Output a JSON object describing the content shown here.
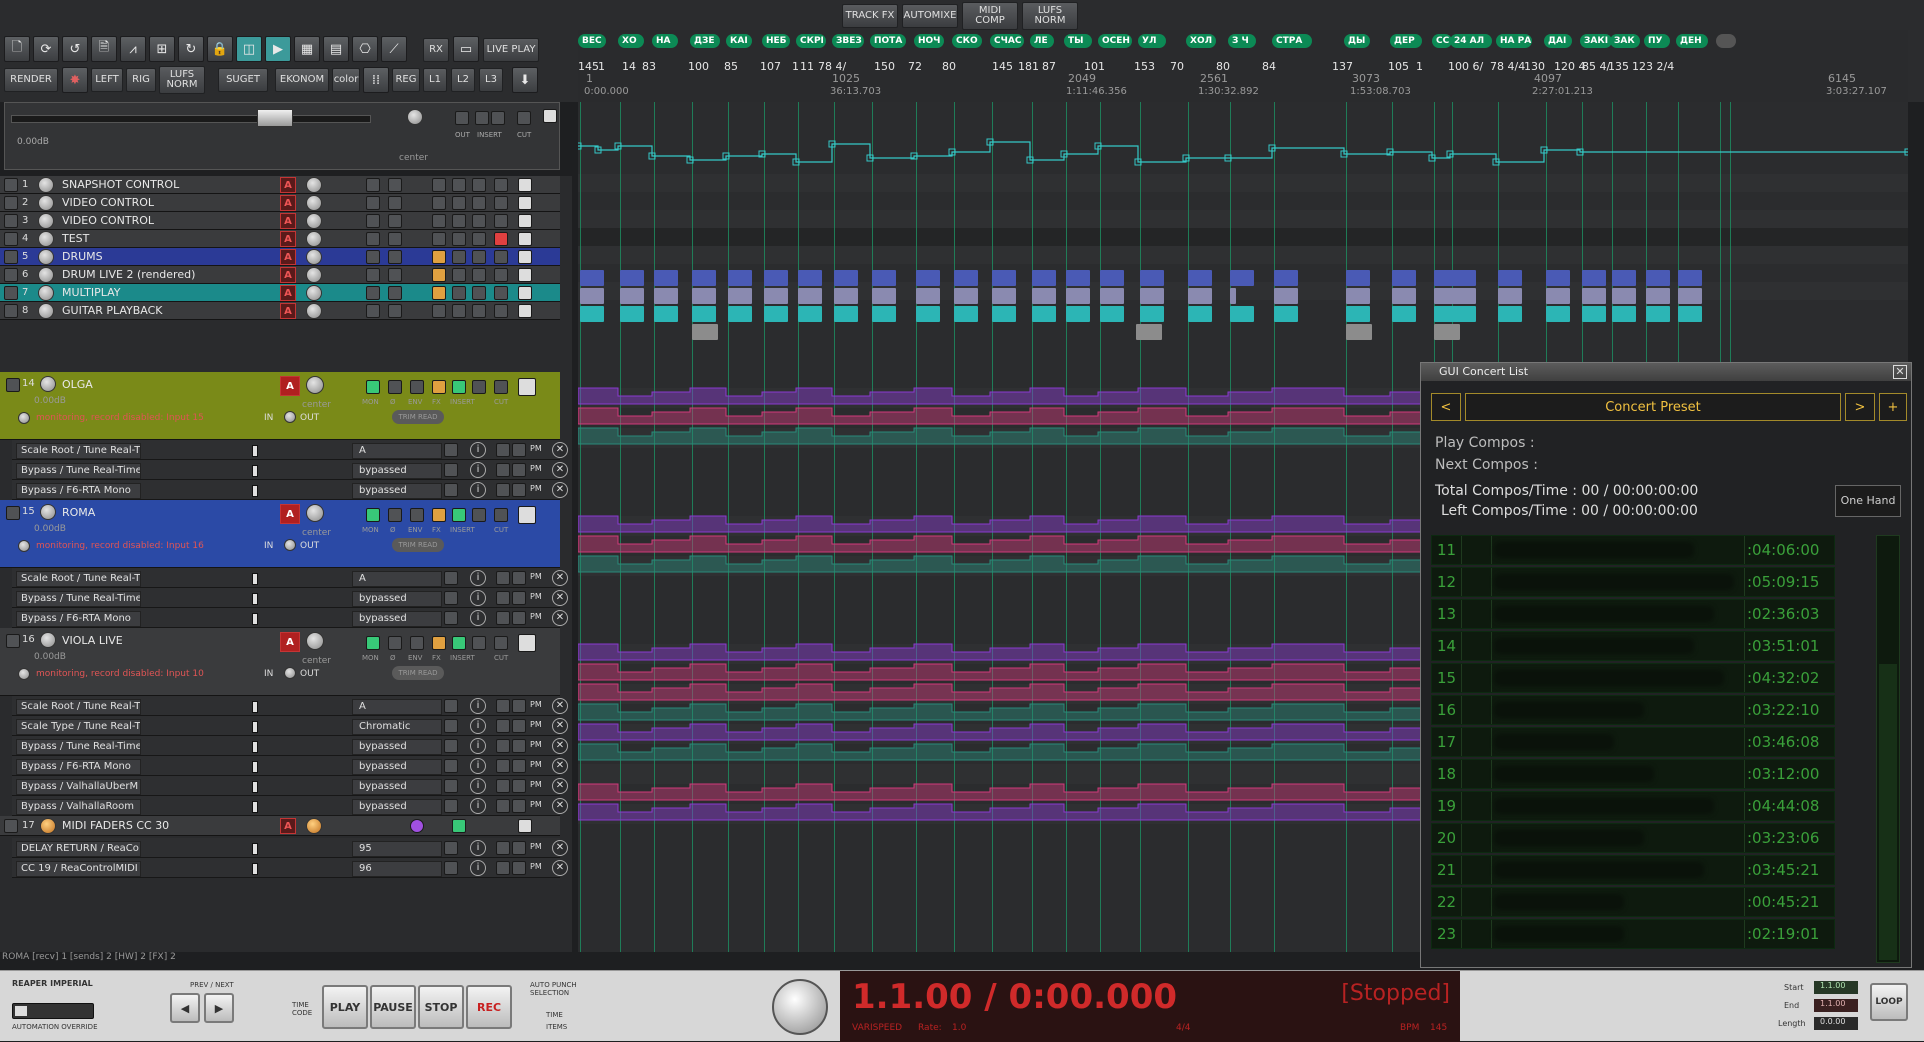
{
  "toolbar": {
    "row1_icons": [
      "new-project-icon",
      "open-project-icon",
      "save-icon",
      "save-as-icon",
      "metronome-icon",
      "grid-icon",
      "loop-icon",
      "lock-icon",
      "snap-icon",
      "ripple-icon",
      "mixer-icon",
      "piano-roll-icon",
      "routing-icon",
      "waveform-icon"
    ],
    "rx": "RX",
    "live_play": "LIVE PLAY",
    "render": "RENDER",
    "left": "LEFT",
    "rig": "RIG",
    "lufs_norm": "LUFS NORM",
    "suget": "SUGET",
    "ekonom": "EKONOM",
    "color": "color",
    "reg": "REG",
    "l1": "L1",
    "l2": "L2",
    "l3": "L3",
    "track_fx": "TRACK FX",
    "automixe": "AUTOMIXE",
    "midi_comp": "MIDI COMP",
    "lufs_norm2": "LUFS NORM"
  },
  "master": {
    "volume": "0.00dB",
    "pan": "center",
    "labels": [
      "OUT",
      "INSERT",
      "CUT"
    ]
  },
  "regions": [
    "ВЕС",
    "ХО",
    "НА",
    "ДЗЕ",
    "КАІ",
    "НЕБ",
    "СКРІ",
    "ЗВЕЗ",
    "ПОТА",
    "НОЧ",
    "СКО",
    "СЧАС",
    "ЛЕ",
    "ТЫ",
    "ОСЕН",
    "УЛ",
    "ХОЛ",
    "З Ч",
    "СТРА",
    "ДЫ",
    "ДЕР",
    "СС",
    "24 АЛ",
    "НА РА",
    "ДАІ",
    "ЗАКІ",
    "ЗАК",
    "ПУ",
    "ДЕН"
  ],
  "marker_numbers": [
    "145",
    "1",
    "14",
    "83",
    "100",
    "85",
    "107",
    "1",
    "11",
    "78 4/",
    "150",
    "72",
    "80",
    "145",
    "181",
    "87",
    "101",
    "153",
    "70",
    "80",
    "84",
    "137",
    "105",
    "1",
    "100 6/",
    "78 4/4",
    "130",
    "120 4",
    "85 4/",
    "135",
    "123 2/4"
  ],
  "bar_numbers": [
    "1",
    "0:00.000",
    "1025",
    "36:13.703",
    "2049",
    "1:11:46.356",
    "2561",
    "1:30:32.892",
    "3073",
    "1:53:08.703",
    "4097",
    "2:27:01.213",
    "6145",
    "3:03:27.107"
  ],
  "tracks": [
    {
      "num": "1",
      "name": "SNAPSHOT CONTROL"
    },
    {
      "num": "2",
      "name": "VIDEO CONTROL"
    },
    {
      "num": "3",
      "name": "VIDEO CONTROL"
    },
    {
      "num": "4",
      "name": "TEST"
    },
    {
      "num": "5",
      "name": "DRUMS"
    },
    {
      "num": "6",
      "name": "DRUM LIVE 2 (rendered)"
    },
    {
      "num": "7",
      "name": "MULTIPLAY"
    },
    {
      "num": "8",
      "name": "GUITAR PLAYBACK"
    }
  ],
  "big_tracks": [
    {
      "num": "14",
      "name": "OLGA",
      "volume": "0.00dB",
      "pan": "center",
      "monitor": "monitoring, record disabled: Input 15",
      "in": "IN",
      "out": "OUT",
      "trim": "TRIM READ",
      "labels": [
        "MON",
        "Ø",
        "ENV",
        "FX",
        "INSERT",
        "CUT"
      ]
    },
    {
      "num": "15",
      "name": "ROMA",
      "volume": "0.00dB",
      "pan": "center",
      "monitor": "monitoring, record disabled: Input 16",
      "in": "IN",
      "out": "OUT",
      "trim": "TRIM READ",
      "labels": [
        "MON",
        "Ø",
        "ENV",
        "FX",
        "INSERT",
        "CUT"
      ]
    },
    {
      "num": "16",
      "name": "VIOLA LIVE",
      "volume": "0.00dB",
      "pan": "center",
      "monitor": "monitoring, record disabled: Input 10",
      "in": "IN",
      "out": "OUT",
      "trim": "TRIM READ",
      "labels": [
        "MON",
        "Ø",
        "ENV",
        "FX",
        "INSERT",
        "CUT"
      ]
    }
  ],
  "env_olga": [
    {
      "name": "Scale Root / Tune Real-T",
      "value": "A"
    },
    {
      "name": "Bypass / Tune Real-Time",
      "value": "bypassed"
    },
    {
      "name": "Bypass / F6-RTA Mono",
      "value": "bypassed"
    }
  ],
  "env_roma": [
    {
      "name": "Scale Root / Tune Real-T",
      "value": "A"
    },
    {
      "name": "Bypass / Tune Real-Time",
      "value": "bypassed"
    },
    {
      "name": "Bypass / F6-RTA Mono",
      "value": "bypassed"
    }
  ],
  "env_viola": [
    {
      "name": "Scale Root / Tune Real-T",
      "value": "A"
    },
    {
      "name": "Scale Type / Tune Real-T",
      "value": "Chromatic"
    },
    {
      "name": "Bypass / Tune Real-Time",
      "value": "bypassed"
    },
    {
      "name": "Bypass / F6-RTA Mono",
      "value": "bypassed"
    },
    {
      "name": "Bypass / ValhallaUberM",
      "value": "bypassed"
    },
    {
      "name": "Bypass / ValhallaRoom",
      "value": "bypassed"
    }
  ],
  "midi_track": {
    "num": "17",
    "name": "MIDI FADERS CC 30"
  },
  "env_midi": [
    {
      "name": "DELAY RETURN / ReaCo",
      "value": "95"
    },
    {
      "name": "CC 19 / ReaControlMIDI",
      "value": "96"
    }
  ],
  "env_pm": "PM",
  "status_line": "ROMA [recv] 1 [sends] 2 [HW] 2 [FX] 2",
  "concert": {
    "title": "GUI Concert List",
    "preset": "Concert Preset",
    "prev": "<",
    "next": ">",
    "add": "+",
    "play_compos": "Play Compos  :",
    "next_compos": "Next Compos :",
    "total": "Total Compos/Time : 00 / 00:00:00:00",
    "left": "Left Compos/Time  : 00 / 00:00:00:00",
    "one_hand": "One Hand",
    "rows": [
      {
        "num": "11",
        "time": ":04:06:00"
      },
      {
        "num": "12",
        "time": ":05:09:15"
      },
      {
        "num": "13",
        "time": ":02:36:03"
      },
      {
        "num": "14",
        "time": ":03:51:01"
      },
      {
        "num": "15",
        "time": ":04:32:02"
      },
      {
        "num": "16",
        "time": ":03:22:10"
      },
      {
        "num": "17",
        "time": ":03:46:08"
      },
      {
        "num": "18",
        "time": ":03:12:00"
      },
      {
        "num": "19",
        "time": ":04:44:08"
      },
      {
        "num": "20",
        "time": ":03:23:06"
      },
      {
        "num": "21",
        "time": ":03:45:21"
      },
      {
        "num": "22",
        "time": ":00:45:21"
      },
      {
        "num": "23",
        "time": ":02:19:01"
      }
    ]
  },
  "transport": {
    "theme": "REAPER IMPERIAL",
    "automation_override": "AUTOMATION OVERRIDE",
    "prev_next": "PREV / NEXT",
    "time_code": "TIME CODE",
    "play": "PLAY",
    "pause": "PAUSE",
    "stop": "STOP",
    "rec": "REC",
    "auto_punch": "AUTO PUNCH SELECTION",
    "time": "TIME",
    "items": "ITEMS",
    "position": "1.1.00 / 0:00.000",
    "state": "[Stopped]",
    "varispeed": "VARISPEED",
    "rate_label": "Rate:",
    "rate": "1.0",
    "time_sig": "4/4",
    "bpm_label": "BPM",
    "bpm": "145",
    "start_label": "Start",
    "end_label": "End",
    "length_label": "Length",
    "start": "1.1.00",
    "end": "1.1.00",
    "length": "0.0.00",
    "loop": "LOOP"
  }
}
